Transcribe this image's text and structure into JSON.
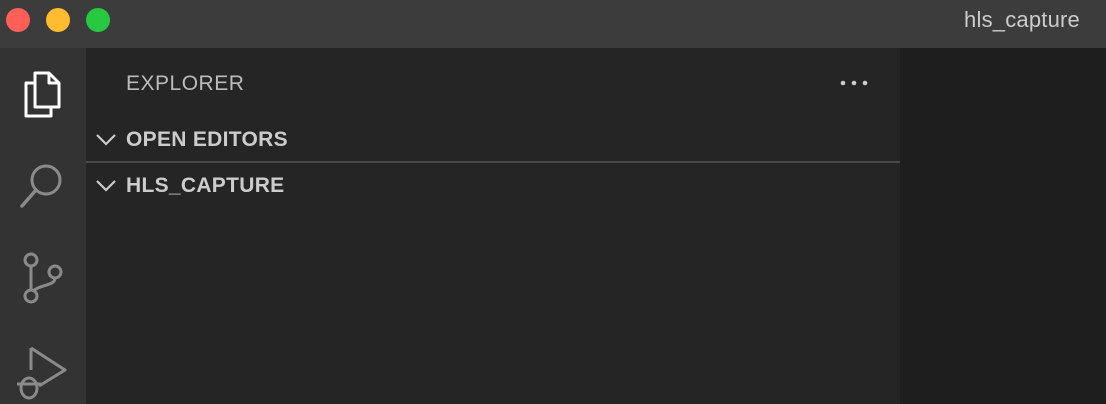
{
  "window": {
    "title": "hls_capture",
    "buttons": [
      "close",
      "minimize",
      "zoom"
    ]
  },
  "activity_bar": {
    "items": [
      {
        "icon": "files-icon",
        "active": true
      },
      {
        "icon": "search-icon",
        "active": false
      },
      {
        "icon": "source-control-icon",
        "active": false
      },
      {
        "icon": "run-debug-icon",
        "active": false
      }
    ]
  },
  "sidebar": {
    "title": "EXPLORER",
    "more_actions_icon": "ellipsis-icon",
    "sections": [
      {
        "label": "OPEN EDITORS",
        "expanded": false
      },
      {
        "label": "HLS_CAPTURE",
        "expanded": false
      }
    ]
  },
  "colors": {
    "titlebar": "#3c3c3c",
    "activity_bar": "#333333",
    "sidebar": "#252526",
    "editor": "#1e1e1e",
    "close": "#fe5f57",
    "minimize": "#febc2e",
    "zoom": "#28c840"
  }
}
